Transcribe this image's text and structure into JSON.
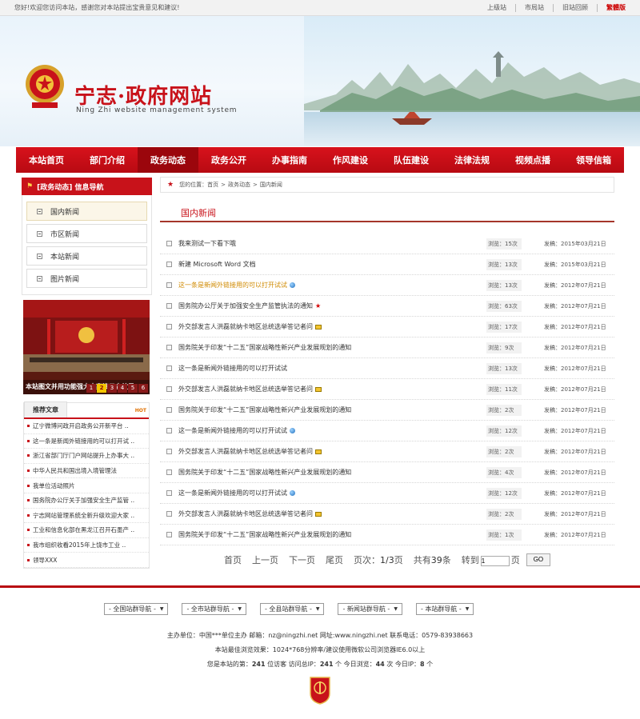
{
  "topbar": {
    "welcome": "您好!欢迎您访问本站，感谢您对本站提出宝贵意见和建议!",
    "links": [
      "上级站",
      "市局站",
      "旧站回顾",
      "繁體版"
    ]
  },
  "header": {
    "title": "宁志·政府网站",
    "subtitle": "Ning Zhi website management system"
  },
  "nav": {
    "items": [
      "本站首页",
      "部门介绍",
      "政务动态",
      "政务公开",
      "办事指南",
      "作风建设",
      "队伍建设",
      "法律法规",
      "视频点播",
      "领导信箱"
    ],
    "active_index": 2
  },
  "sidebar": {
    "heading": "[政务动态] 信息导航",
    "items": [
      "国内新闻",
      "市区新闻",
      "本站新闻",
      "图片新闻"
    ],
    "active_index": 0,
    "slide_caption": "本站图文并用功能强大大家演示去效果",
    "slide_pages": [
      "1",
      "2",
      "3",
      "4",
      "5",
      "6"
    ],
    "slide_active_page": "2",
    "recommend_title": "推荐文章",
    "recommend_hot": "HOT",
    "recommend": [
      "辽宁微博问政开启政务公开新平台 ..",
      "这一条是新闻外链接用的可以打开试 ..",
      "浙江省部门厅门户网站提升上办事大 ..",
      "中华人民共和国出境入境管理法",
      "我单位活动照片",
      "国务院办公厅关于加强安全生产监管 ..",
      "宁志网站管理系统全新升级欢迎大家 ..",
      "工业和信息化部在黑龙江召开石墨产 ..",
      "我市组织收看2015年上饶市工业 ..",
      "领导XXX"
    ]
  },
  "breadcrumb": {
    "prefix": "您的位置：",
    "items": [
      "首页",
      "政务动态",
      "国内新闻"
    ],
    "separator": ">"
  },
  "section_title": "国内新闻",
  "news": [
    {
      "title": "我来测试一下看下哦",
      "views": "浏览：15次",
      "date": "发稿：2015年03月21日",
      "mark": "",
      "highlight": false
    },
    {
      "title": "新建 Microsoft Word 文档",
      "views": "浏览：13次",
      "date": "发稿：2015年03月21日",
      "mark": "",
      "highlight": false
    },
    {
      "title": "这一条是新闻外链接用的可以打开试试",
      "views": "浏览：13次",
      "date": "发稿：2012年07月21日",
      "mark": "globe",
      "highlight": true
    },
    {
      "title": "国务院办公厅关于加强安全生产监管执法的通知",
      "views": "浏览：63次",
      "date": "发稿：2012年07月21日",
      "mark": "star",
      "highlight": false
    },
    {
      "title": "外交部发言人洪磊就纳卡地区总统选举答记者问",
      "views": "浏览：17次",
      "date": "发稿：2012年07月21日",
      "mark": "mail",
      "highlight": false
    },
    {
      "title": "国务院关于印发“十二五”国家战略性新兴产业发展规划的通知",
      "views": "浏览：9次",
      "date": "发稿：2012年07月21日",
      "mark": "",
      "highlight": false
    },
    {
      "title": "这一条是新闻外链接用的可以打开试试",
      "views": "浏览：13次",
      "date": "发稿：2012年07月21日",
      "mark": "",
      "highlight": false
    },
    {
      "title": "外交部发言人洪磊就纳卡地区总统选举答记者问",
      "views": "浏览：11次",
      "date": "发稿：2012年07月21日",
      "mark": "mail",
      "highlight": false
    },
    {
      "title": "国务院关于印发“十二五”国家战略性新兴产业发展规划的通知",
      "views": "浏览：2次",
      "date": "发稿：2012年07月21日",
      "mark": "",
      "highlight": false
    },
    {
      "title": "这一条是新闻外链接用的可以打开试试",
      "views": "浏览：12次",
      "date": "发稿：2012年07月21日",
      "mark": "globe",
      "highlight": false
    },
    {
      "title": "外交部发言人洪磊就纳卡地区总统选举答记者问",
      "views": "浏览：2次",
      "date": "发稿：2012年07月21日",
      "mark": "mail",
      "highlight": false
    },
    {
      "title": "国务院关于印发“十二五”国家战略性新兴产业发展规划的通知",
      "views": "浏览：4次",
      "date": "发稿：2012年07月21日",
      "mark": "",
      "highlight": false
    },
    {
      "title": "这一条是新闻外链接用的可以打开试试",
      "views": "浏览：12次",
      "date": "发稿：2012年07月21日",
      "mark": "globe",
      "highlight": false
    },
    {
      "title": "外交部发言人洪磊就纳卡地区总统选举答记者问",
      "views": "浏览：2次",
      "date": "发稿：2012年07月21日",
      "mark": "mail",
      "highlight": false
    },
    {
      "title": "国务院关于印发“十二五”国家战略性新兴产业发展规划的通知",
      "views": "浏览：1次",
      "date": "发稿：2012年07月21日",
      "mark": "",
      "highlight": false
    }
  ],
  "pagination": {
    "first": "首页",
    "prev": "上一页",
    "next": "下一页",
    "last": "尾页",
    "page_label": "页次：",
    "page": "1/3",
    "page_suffix": "页",
    "total_prefix": "共有",
    "total": "39",
    "total_suffix": "条",
    "goto_prefix": "转到",
    "goto_value": "1",
    "goto_suffix": "页",
    "go_button": "GO"
  },
  "footer": {
    "selects": [
      "- 全国站群导航 -",
      "- 全市站群导航 -",
      "- 全县站群导航 -",
      "- 新闻站群导航 -",
      "- 本站群导航 -"
    ],
    "line1": "主办单位：中国***单位主办  邮箱：nz@ningzhi.net  网址:www.ningzhi.net  联系电话：0579-83938663",
    "line2": "本站最佳浏览效果：1024*768分辨率/建议使用微软公司浏览器IE6.0以上",
    "stats_prefix": "您是本站的第：",
    "visitor_no": "241",
    "stats_visitor_suffix": " 位访客  访问总IP：",
    "total_ip": "241",
    "stats_mid": " 个  今日浏览：",
    "today_views": "44",
    "stats_mid2": " 次  今日IP：",
    "today_ip": "8",
    "stats_suffix": " 个",
    "seal_text": "党政机关"
  },
  "colors": {
    "brand_red": "#c8121a",
    "nav_active": "#9b060c",
    "highlight_title": "#d08a00"
  }
}
